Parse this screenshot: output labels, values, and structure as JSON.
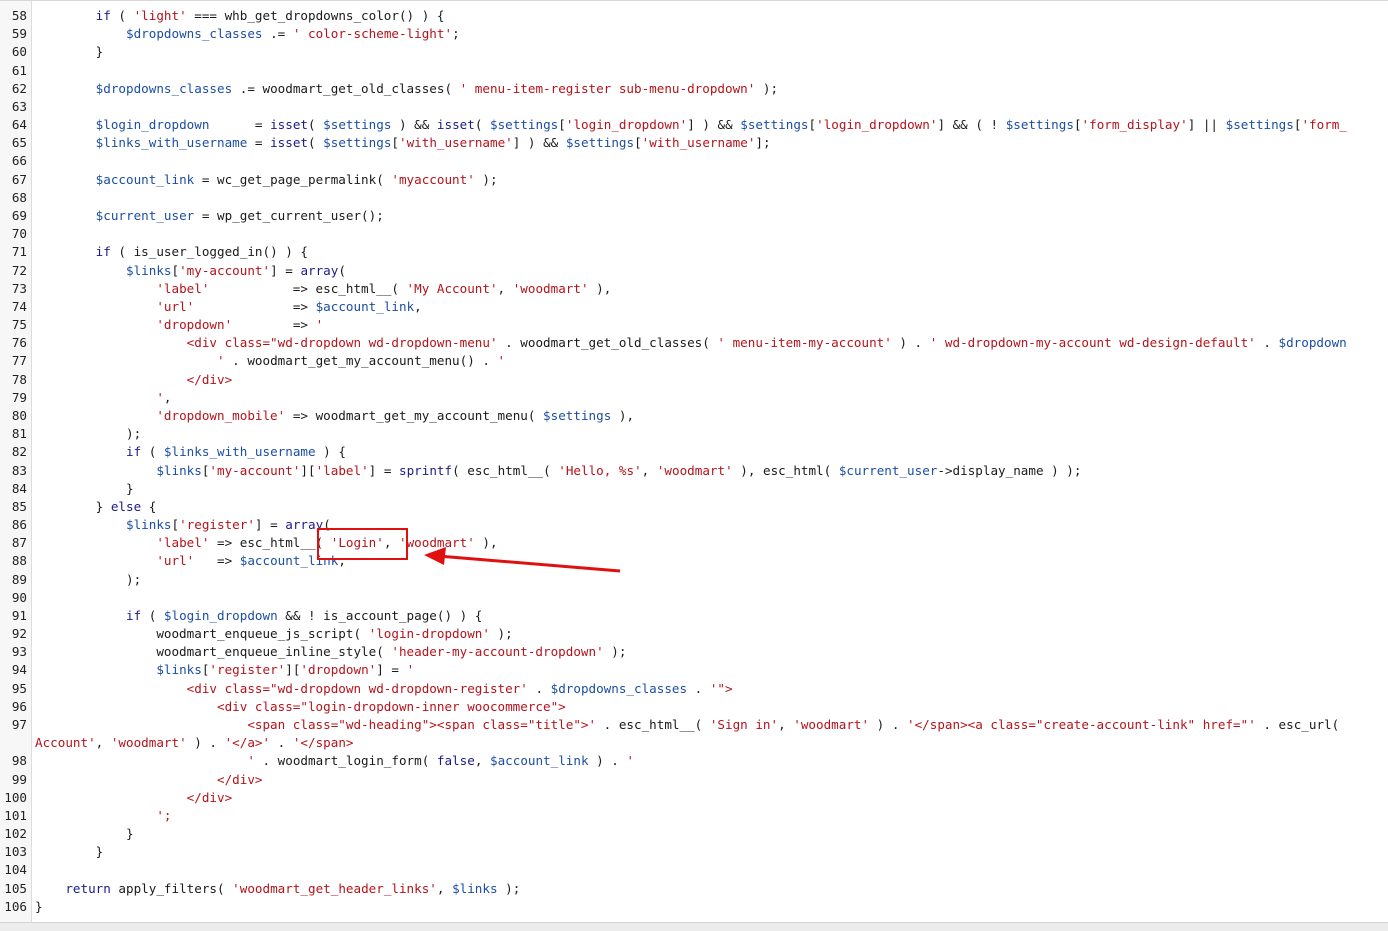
{
  "editor": {
    "lines": [
      {
        "n": "58",
        "segs": [
          [
            "",
            "        "
          ],
          [
            "kw",
            "if"
          ],
          [
            "",
            " ( "
          ],
          [
            "str",
            "'light'"
          ],
          [
            "",
            " === whb_get_dropdowns_color() ) {"
          ]
        ]
      },
      {
        "n": "59",
        "segs": [
          [
            "",
            "            "
          ],
          [
            "var",
            "$dropdowns_classes"
          ],
          [
            "",
            " .= "
          ],
          [
            "str",
            "' color-scheme-light'"
          ],
          [
            "",
            ";"
          ]
        ]
      },
      {
        "n": "60",
        "segs": [
          [
            "",
            "        }"
          ]
        ]
      },
      {
        "n": "61",
        "segs": []
      },
      {
        "n": "62",
        "segs": [
          [
            "",
            "        "
          ],
          [
            "var",
            "$dropdowns_classes"
          ],
          [
            "",
            " .= woodmart_get_old_classes( "
          ],
          [
            "str",
            "' menu-item-register sub-menu-dropdown'"
          ],
          [
            "",
            " );"
          ]
        ]
      },
      {
        "n": "63",
        "segs": []
      },
      {
        "n": "64",
        "segs": [
          [
            "",
            "        "
          ],
          [
            "var",
            "$login_dropdown"
          ],
          [
            "",
            "      = "
          ],
          [
            "kw",
            "isset"
          ],
          [
            "",
            "( "
          ],
          [
            "var",
            "$settings"
          ],
          [
            "",
            " ) && "
          ],
          [
            "kw",
            "isset"
          ],
          [
            "",
            "( "
          ],
          [
            "var",
            "$settings"
          ],
          [
            "",
            "["
          ],
          [
            "str",
            "'login_dropdown'"
          ],
          [
            "",
            "] ) && "
          ],
          [
            "var",
            "$settings"
          ],
          [
            "",
            "["
          ],
          [
            "str",
            "'login_dropdown'"
          ],
          [
            "",
            "] && ( ! "
          ],
          [
            "var",
            "$settings"
          ],
          [
            "",
            "["
          ],
          [
            "str",
            "'form_display'"
          ],
          [
            "",
            "] || "
          ],
          [
            "var",
            "$settings"
          ],
          [
            "",
            "["
          ],
          [
            "str",
            "'form_"
          ]
        ]
      },
      {
        "n": "65",
        "segs": [
          [
            "",
            "        "
          ],
          [
            "var",
            "$links_with_username"
          ],
          [
            "",
            " = "
          ],
          [
            "kw",
            "isset"
          ],
          [
            "",
            "( "
          ],
          [
            "var",
            "$settings"
          ],
          [
            "",
            "["
          ],
          [
            "str",
            "'with_username'"
          ],
          [
            "",
            "] ) && "
          ],
          [
            "var",
            "$settings"
          ],
          [
            "",
            "["
          ],
          [
            "str",
            "'with_username'"
          ],
          [
            "",
            "];"
          ]
        ]
      },
      {
        "n": "66",
        "segs": []
      },
      {
        "n": "67",
        "segs": [
          [
            "",
            "        "
          ],
          [
            "var",
            "$account_link"
          ],
          [
            "",
            " = wc_get_page_permalink( "
          ],
          [
            "str",
            "'myaccount'"
          ],
          [
            "",
            " );"
          ]
        ]
      },
      {
        "n": "68",
        "segs": []
      },
      {
        "n": "69",
        "segs": [
          [
            "",
            "        "
          ],
          [
            "var",
            "$current_user"
          ],
          [
            "",
            " = wp_get_current_user();"
          ]
        ]
      },
      {
        "n": "70",
        "segs": []
      },
      {
        "n": "71",
        "segs": [
          [
            "",
            "        "
          ],
          [
            "kw",
            "if"
          ],
          [
            "",
            " ( is_user_logged_in() ) {"
          ]
        ]
      },
      {
        "n": "72",
        "segs": [
          [
            "",
            "            "
          ],
          [
            "var",
            "$links"
          ],
          [
            "",
            "["
          ],
          [
            "str",
            "'my-account'"
          ],
          [
            "",
            "] = "
          ],
          [
            "kw",
            "array"
          ],
          [
            "",
            "("
          ]
        ]
      },
      {
        "n": "73",
        "segs": [
          [
            "",
            "                "
          ],
          [
            "str",
            "'label'"
          ],
          [
            "",
            "           => esc_html__( "
          ],
          [
            "str",
            "'My Account'"
          ],
          [
            "",
            ", "
          ],
          [
            "str",
            "'woodmart'"
          ],
          [
            "",
            " ),"
          ]
        ]
      },
      {
        "n": "74",
        "segs": [
          [
            "",
            "                "
          ],
          [
            "str",
            "'url'"
          ],
          [
            "",
            "             => "
          ],
          [
            "var",
            "$account_link"
          ],
          [
            "",
            ","
          ]
        ]
      },
      {
        "n": "75",
        "segs": [
          [
            "",
            "                "
          ],
          [
            "str",
            "'dropdown'"
          ],
          [
            "",
            "        => "
          ],
          [
            "str",
            "'"
          ]
        ]
      },
      {
        "n": "76",
        "segs": [
          [
            "",
            "                    "
          ],
          [
            "tag",
            "<div class=\"wd-dropdown wd-dropdown-menu'"
          ],
          [
            "",
            " . woodmart_get_old_classes( "
          ],
          [
            "str",
            "' menu-item-my-account'"
          ],
          [
            "",
            " ) . "
          ],
          [
            "str",
            "' wd-dropdown-my-account wd-design-default'"
          ],
          [
            "",
            " . "
          ],
          [
            "var",
            "$dropdown"
          ]
        ]
      },
      {
        "n": "77",
        "segs": [
          [
            "",
            "                        "
          ],
          [
            "str",
            "'"
          ],
          [
            "",
            " . woodmart_get_my_account_menu() . "
          ],
          [
            "str",
            "'"
          ]
        ]
      },
      {
        "n": "78",
        "segs": [
          [
            "",
            "                    "
          ],
          [
            "tag",
            "</div>"
          ]
        ]
      },
      {
        "n": "79",
        "segs": [
          [
            "",
            "                "
          ],
          [
            "str",
            "'"
          ],
          [
            "",
            ","
          ]
        ]
      },
      {
        "n": "80",
        "segs": [
          [
            "",
            "                "
          ],
          [
            "str",
            "'dropdown_mobile'"
          ],
          [
            "",
            " => woodmart_get_my_account_menu( "
          ],
          [
            "var",
            "$settings"
          ],
          [
            "",
            " ),"
          ]
        ]
      },
      {
        "n": "81",
        "segs": [
          [
            "",
            "            );"
          ]
        ]
      },
      {
        "n": "82",
        "segs": [
          [
            "",
            "            "
          ],
          [
            "kw",
            "if"
          ],
          [
            "",
            " ( "
          ],
          [
            "var",
            "$links_with_username"
          ],
          [
            "",
            " ) {"
          ]
        ]
      },
      {
        "n": "83",
        "segs": [
          [
            "",
            "                "
          ],
          [
            "var",
            "$links"
          ],
          [
            "",
            "["
          ],
          [
            "str",
            "'my-account'"
          ],
          [
            "",
            "]["
          ],
          [
            "str",
            "'label'"
          ],
          [
            "",
            "] = "
          ],
          [
            "kw",
            "sprintf"
          ],
          [
            "",
            "( esc_html__( "
          ],
          [
            "str",
            "'Hello, %s'"
          ],
          [
            "",
            ", "
          ],
          [
            "str",
            "'woodmart'"
          ],
          [
            "",
            " ), esc_html( "
          ],
          [
            "var",
            "$current_user"
          ],
          [
            "",
            "->display_name ) );"
          ]
        ]
      },
      {
        "n": "84",
        "segs": [
          [
            "",
            "            }"
          ]
        ]
      },
      {
        "n": "85",
        "segs": [
          [
            "",
            "        } "
          ],
          [
            "kw",
            "else"
          ],
          [
            "",
            " {"
          ]
        ]
      },
      {
        "n": "86",
        "segs": [
          [
            "",
            "            "
          ],
          [
            "var",
            "$links"
          ],
          [
            "",
            "["
          ],
          [
            "str",
            "'register'"
          ],
          [
            "",
            "] = "
          ],
          [
            "kw",
            "array"
          ],
          [
            "",
            "("
          ]
        ]
      },
      {
        "n": "87",
        "segs": [
          [
            "",
            "                "
          ],
          [
            "str",
            "'label'"
          ],
          [
            "",
            " => esc_html__( "
          ],
          [
            "str",
            "'Login'"
          ],
          [
            "",
            ", "
          ],
          [
            "str",
            "'woodmart'"
          ],
          [
            "",
            " ),"
          ]
        ]
      },
      {
        "n": "88",
        "segs": [
          [
            "",
            "                "
          ],
          [
            "str",
            "'url'"
          ],
          [
            "",
            "   => "
          ],
          [
            "var",
            "$account_link"
          ],
          [
            "",
            ","
          ]
        ]
      },
      {
        "n": "89",
        "segs": [
          [
            "",
            "            );"
          ]
        ]
      },
      {
        "n": "90",
        "segs": []
      },
      {
        "n": "91",
        "segs": [
          [
            "",
            "            "
          ],
          [
            "kw",
            "if"
          ],
          [
            "",
            " ( "
          ],
          [
            "var",
            "$login_dropdown"
          ],
          [
            "",
            " && ! is_account_page() ) {"
          ]
        ]
      },
      {
        "n": "92",
        "segs": [
          [
            "",
            "                woodmart_enqueue_js_script( "
          ],
          [
            "str",
            "'login-dropdown'"
          ],
          [
            "",
            " );"
          ]
        ]
      },
      {
        "n": "93",
        "segs": [
          [
            "",
            "                woodmart_enqueue_inline_style( "
          ],
          [
            "str",
            "'header-my-account-dropdown'"
          ],
          [
            "",
            " );"
          ]
        ]
      },
      {
        "n": "94",
        "segs": [
          [
            "",
            "                "
          ],
          [
            "var",
            "$links"
          ],
          [
            "",
            "["
          ],
          [
            "str",
            "'register'"
          ],
          [
            "",
            "]["
          ],
          [
            "str",
            "'dropdown'"
          ],
          [
            "",
            "] = "
          ],
          [
            "str",
            "'"
          ]
        ]
      },
      {
        "n": "95",
        "segs": [
          [
            "",
            "                    "
          ],
          [
            "tag",
            "<div class=\"wd-dropdown wd-dropdown-register'"
          ],
          [
            "",
            " . "
          ],
          [
            "var",
            "$dropdowns_classes"
          ],
          [
            "",
            " . "
          ],
          [
            "str",
            "'\">"
          ]
        ]
      },
      {
        "n": "96",
        "segs": [
          [
            "",
            "                        "
          ],
          [
            "tag",
            "<div class=\"login-dropdown-inner woocommerce\">"
          ]
        ]
      },
      {
        "n": "97",
        "segs": [
          [
            "",
            "                            "
          ],
          [
            "tag",
            "<span class=\"wd-heading\"><span class=\"title\">'"
          ],
          [
            "",
            " . esc_html__( "
          ],
          [
            "str",
            "'Sign in'"
          ],
          [
            "",
            ", "
          ],
          [
            "str",
            "'woodmart'"
          ],
          [
            "",
            " ) . "
          ],
          [
            "str",
            "'</span><a class=\"create-account-link\" href=\"'"
          ],
          [
            "",
            " . esc_url("
          ]
        ]
      },
      {
        "n": "",
        "segs": [
          [
            "str",
            "Account'"
          ],
          [
            "",
            ", "
          ],
          [
            "str",
            "'woodmart'"
          ],
          [
            "",
            " ) . "
          ],
          [
            "str",
            "'</a>'"
          ],
          [
            "",
            " . "
          ],
          [
            "str",
            "'</span>"
          ]
        ]
      },
      {
        "n": "98",
        "segs": [
          [
            "",
            "                            "
          ],
          [
            "str",
            "'"
          ],
          [
            "",
            " . woodmart_login_form( "
          ],
          [
            "kw",
            "false"
          ],
          [
            "",
            ", "
          ],
          [
            "var",
            "$account_link"
          ],
          [
            "",
            " ) . "
          ],
          [
            "str",
            "'"
          ]
        ]
      },
      {
        "n": "99",
        "segs": [
          [
            "",
            "                        "
          ],
          [
            "tag",
            "</div>"
          ]
        ]
      },
      {
        "n": "100",
        "segs": [
          [
            "",
            "                    "
          ],
          [
            "tag",
            "</div>"
          ]
        ]
      },
      {
        "n": "101",
        "segs": [
          [
            "",
            "                "
          ],
          [
            "str",
            "';"
          ]
        ]
      },
      {
        "n": "102",
        "segs": [
          [
            "",
            "            }"
          ]
        ]
      },
      {
        "n": "103",
        "segs": [
          [
            "",
            "        }"
          ]
        ]
      },
      {
        "n": "104",
        "segs": []
      },
      {
        "n": "105",
        "segs": [
          [
            "",
            "    "
          ],
          [
            "kw",
            "return"
          ],
          [
            "",
            " apply_filters( "
          ],
          [
            "str",
            "'woodmart_get_header_links'"
          ],
          [
            "",
            ", "
          ],
          [
            "var",
            "$links"
          ],
          [
            "",
            " );"
          ]
        ]
      },
      {
        "n": "106",
        "segs": [
          [
            "",
            "}"
          ]
        ]
      }
    ]
  },
  "annotation": {
    "box_color": "#e01010",
    "arrow_color": "#e01010"
  },
  "colors": {
    "keyword": "#1a1a8c",
    "variable": "#1c4ea3",
    "string": "#b5131b",
    "text": "#1a1a1a"
  }
}
